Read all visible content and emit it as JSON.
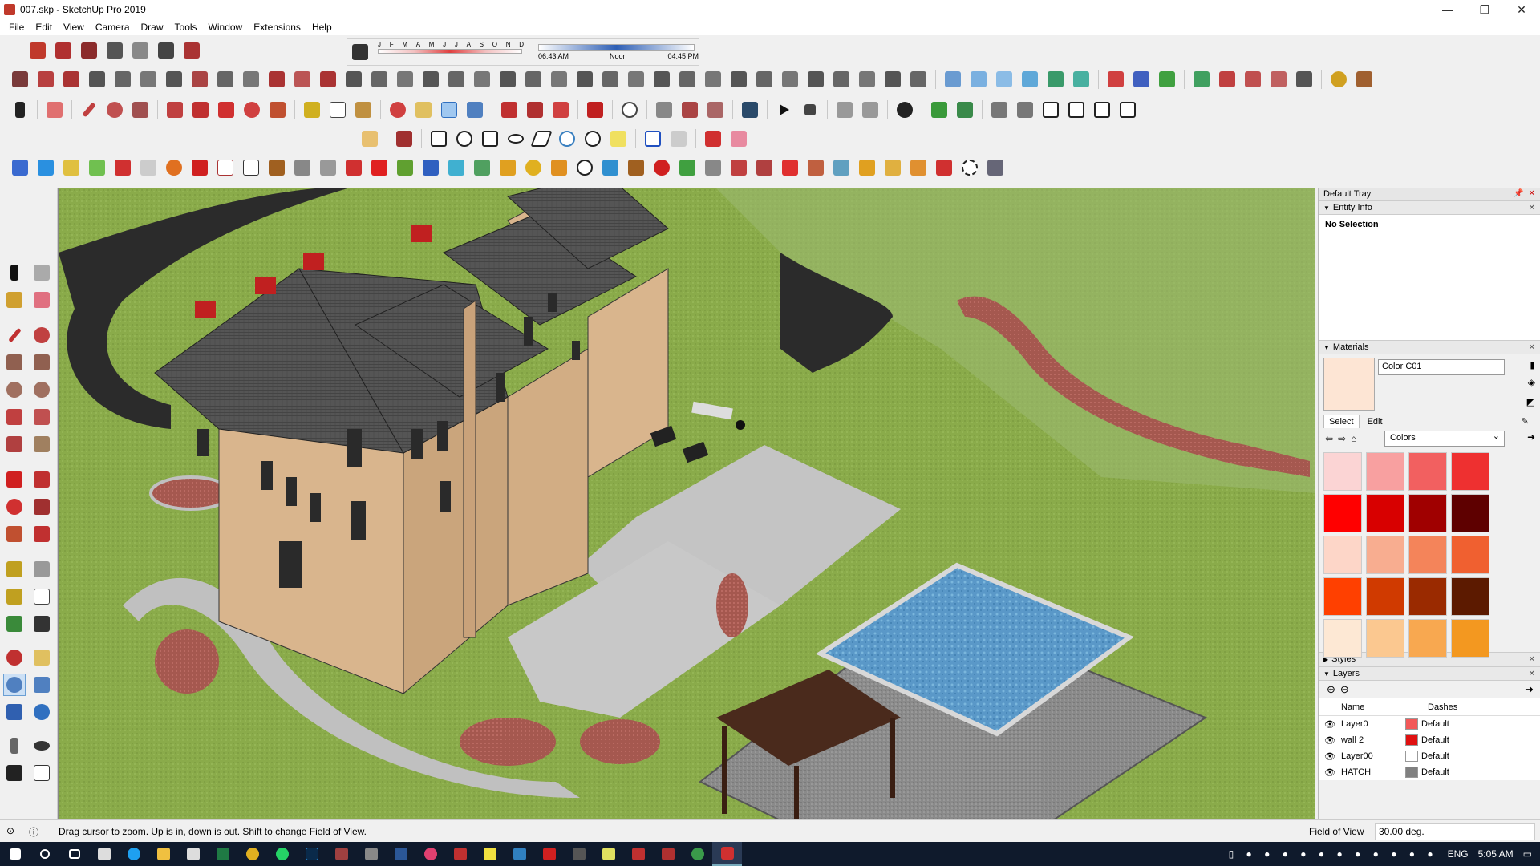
{
  "window": {
    "title": "007.skp - SketchUp Pro 2019",
    "controls": [
      "—",
      "❐",
      "✕"
    ]
  },
  "menu": [
    "File",
    "Edit",
    "View",
    "Camera",
    "Draw",
    "Tools",
    "Window",
    "Extensions",
    "Help"
  ],
  "shadow": {
    "months": [
      "J",
      "F",
      "M",
      "A",
      "M",
      "J",
      "J",
      "A",
      "S",
      "O",
      "N",
      "D"
    ],
    "time_start": "06:43 AM",
    "time_mid": "Noon",
    "time_end": "04:45 PM"
  },
  "tray": {
    "title": "Default Tray",
    "entity_info": {
      "label": "Entity Info",
      "value": "No Selection"
    },
    "materials": {
      "label": "Materials",
      "name": "Color C01",
      "swatch": "#fde5d4",
      "tabs": [
        "Select",
        "Edit"
      ],
      "library": "Colors",
      "swatches": [
        "#fbd4d4",
        "#f8a0a0",
        "#f26060",
        "#ee3030",
        "#ff0000",
        "#d80000",
        "#a00000",
        "#5e0000",
        "#fdd6c8",
        "#f8ad90",
        "#f4845a",
        "#f06030",
        "#ff4000",
        "#d03a00",
        "#9a2a00",
        "#5c1a00",
        "#fde8d4",
        "#fbc890",
        "#f8a850",
        "#f39820"
      ]
    },
    "styles": {
      "label": "Styles"
    },
    "layers": {
      "label": "Layers",
      "col_name": "Name",
      "col_dashes": "Dashes",
      "rows": [
        {
          "name": "Layer0",
          "color": "#f25858",
          "dashes": "Default"
        },
        {
          "name": "wall 2",
          "color": "#e01010",
          "dashes": "Default"
        },
        {
          "name": "Layer00",
          "color": "#ffffff",
          "dashes": "Default"
        },
        {
          "name": "HATCH",
          "color": "#808080",
          "dashes": "Default"
        }
      ]
    }
  },
  "status": {
    "message": "Drag cursor to zoom.  Up is in, down is out. Shift to change Field of View.",
    "fov_label": "Field of View",
    "fov_value": "30.00 deg."
  },
  "taskbar": {
    "lang": "ENG",
    "time": "5:05 AM"
  }
}
